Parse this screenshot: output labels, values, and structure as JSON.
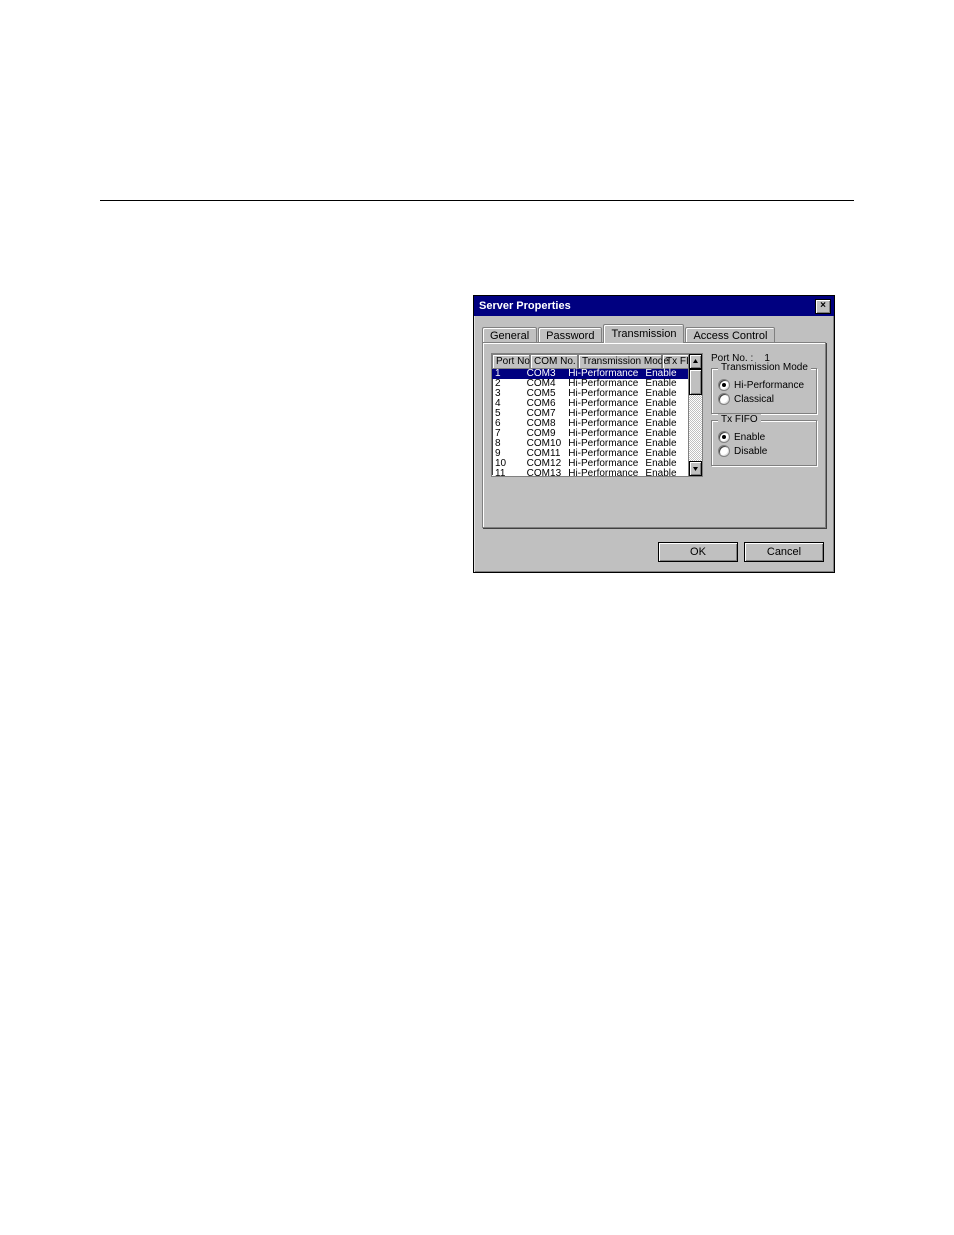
{
  "dialog": {
    "title": "Server Properties",
    "close_glyph": "×"
  },
  "tabs": {
    "items": [
      {
        "label": "General"
      },
      {
        "label": "Password"
      },
      {
        "label": "Transmission"
      },
      {
        "label": "Access Control"
      }
    ],
    "active_index": 2
  },
  "list": {
    "headers": {
      "port": "Port No.",
      "com": "COM No.",
      "mode": "Transmission Mode",
      "fifo": "Tx FIFO"
    },
    "rows": [
      {
        "port": "1",
        "com": "COM3",
        "mode": "Hi-Performance",
        "fifo": "Enable",
        "selected": true
      },
      {
        "port": "2",
        "com": "COM4",
        "mode": "Hi-Performance",
        "fifo": "Enable"
      },
      {
        "port": "3",
        "com": "COM5",
        "mode": "Hi-Performance",
        "fifo": "Enable"
      },
      {
        "port": "4",
        "com": "COM6",
        "mode": "Hi-Performance",
        "fifo": "Enable"
      },
      {
        "port": "5",
        "com": "COM7",
        "mode": "Hi-Performance",
        "fifo": "Enable"
      },
      {
        "port": "6",
        "com": "COM8",
        "mode": "Hi-Performance",
        "fifo": "Enable"
      },
      {
        "port": "7",
        "com": "COM9",
        "mode": "Hi-Performance",
        "fifo": "Enable"
      },
      {
        "port": "8",
        "com": "COM10",
        "mode": "Hi-Performance",
        "fifo": "Enable"
      },
      {
        "port": "9",
        "com": "COM11",
        "mode": "Hi-Performance",
        "fifo": "Enable"
      },
      {
        "port": "10",
        "com": "COM12",
        "mode": "Hi-Performance",
        "fifo": "Enable"
      },
      {
        "port": "11",
        "com": "COM13",
        "mode": "Hi-Performance",
        "fifo": "Enable"
      }
    ]
  },
  "right": {
    "port_label": "Port No. :",
    "port_value": "1",
    "mode_group": {
      "title": "Transmission Mode",
      "options": [
        {
          "label": "Hi-Performance",
          "checked": true
        },
        {
          "label": "Classical",
          "checked": false
        }
      ]
    },
    "fifo_group": {
      "title": "Tx FIFO",
      "options": [
        {
          "label": "Enable",
          "checked": true
        },
        {
          "label": "Disable",
          "checked": false
        }
      ]
    }
  },
  "buttons": {
    "ok": "OK",
    "cancel": "Cancel"
  }
}
